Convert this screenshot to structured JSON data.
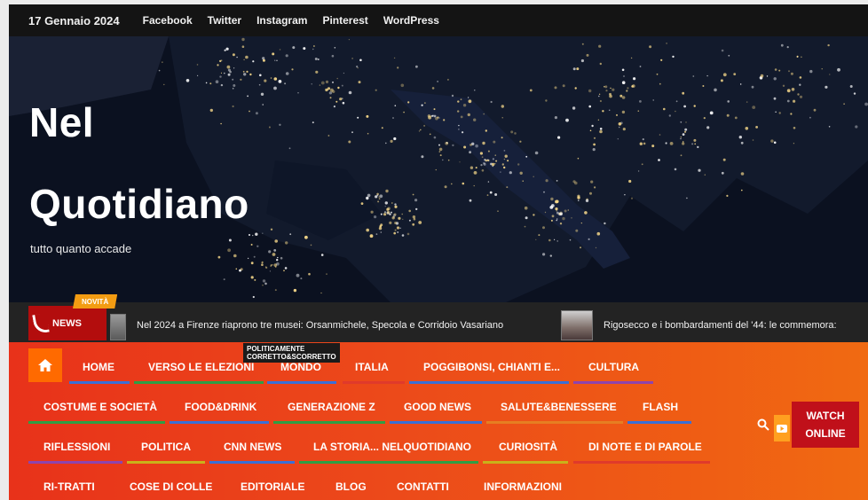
{
  "topbar": {
    "date": "17 Gennaio 2024",
    "social_links": [
      "Facebook",
      "Twitter",
      "Instagram",
      "Pinterest",
      "WordPress"
    ]
  },
  "site": {
    "title_line1": "Nel",
    "title_line2": "Quotidiano",
    "tagline": "tutto quanto accade"
  },
  "ticker": {
    "label": "NEWS",
    "badge": "NOVITÀ",
    "items": [
      "Nel 2024 a Firenze riaprono tre musei: Orsanmichele, Specola e Corridoio Vasariano",
      "Rigosecco e i bombardamenti del '44: le commemora:"
    ]
  },
  "nav": {
    "row1": [
      "HOME",
      "VERSO LE ELEZIONI",
      "MONDO",
      "ITALIA",
      "POGGIBONSI, CHIANTI E...",
      "CULTURA"
    ],
    "row2": [
      "COSTUME E SOCIETÀ",
      "FOOD&DRINK",
      "GENERAZIONE Z",
      "GOOD NEWS",
      "SALUTE&BENESSERE",
      "FLASH"
    ],
    "row3": [
      "RIFLESSIONI",
      "POLITICA",
      "CNN NEWS",
      "LA STORIA... NELQUOTIDIANO",
      "CURIOSITÀ",
      "DI NOTE E DI PAROLE"
    ],
    "row4": [
      "RI-TRATTI",
      "COSE DI COLLE",
      "EDITORIALE",
      "BLOG",
      "CONTATTI",
      "INFORMAZIONI"
    ],
    "tooltip_line1": "POLITICAMENTE",
    "tooltip_line2": "CORRETTO&SCORRETTO"
  },
  "watch": {
    "line1": "WATCH",
    "line2": "ONLINE"
  },
  "colors": {
    "nav_bg": "#ec4a1a",
    "home_btn": "#ff6a00",
    "watch_btn": "#c0101a",
    "novita_badge": "#f39c12",
    "news_label": "#b30d0d"
  },
  "icons": [
    "home-icon",
    "search-icon",
    "youtube-icon",
    "news-icon"
  ]
}
